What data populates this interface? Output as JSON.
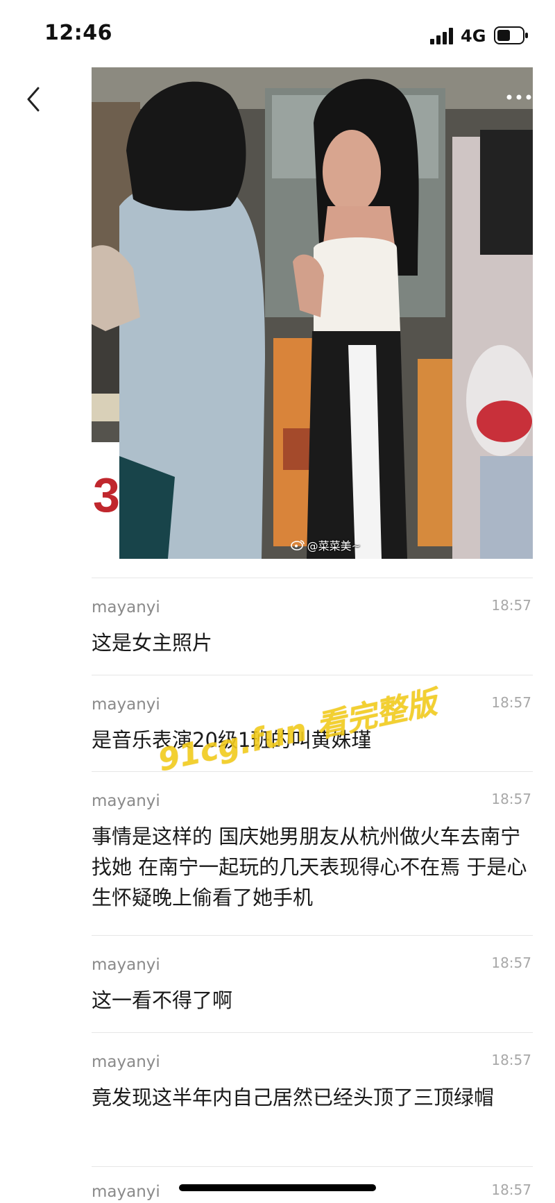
{
  "status_bar": {
    "time": "12:46",
    "network": "4G",
    "signal_icon": "signal-bars-icon",
    "battery_icon": "battery-icon"
  },
  "nav": {
    "back_icon": "chevron-left-icon",
    "more_icon": "more-dots-icon"
  },
  "photo": {
    "credit": "@菜菜美~",
    "credit_icon": "weibo-icon"
  },
  "messages": [
    {
      "author": "mayanyi",
      "time": "18:57",
      "text": "这是女主照片"
    },
    {
      "author": "mayanyi",
      "time": "18:57",
      "text": "是音乐表演20级1班的叫黄姝瑾"
    },
    {
      "author": "mayanyi",
      "time": "18:57",
      "text": "事情是这样的 国庆她男朋友从杭州做火车去南宁找她 在南宁一起玩的几天表现得心不在焉  于是心生怀疑晚上偷看了她手机"
    },
    {
      "author": "mayanyi",
      "time": "18:57",
      "text": "这一看不得了啊"
    },
    {
      "author": "mayanyi",
      "time": "18:57",
      "text": "竟发现这半年内自己居然已经头顶了三顶绿帽"
    },
    {
      "author": "mayanyi",
      "time": "18:57",
      "text": ""
    }
  ],
  "overlay_watermark": "91cg.fun 看完整版",
  "colors": {
    "watermark": "#f1cb1c",
    "author": "#8a8a8a",
    "time": "#a8a8a8",
    "divider": "#e6e6e6"
  }
}
